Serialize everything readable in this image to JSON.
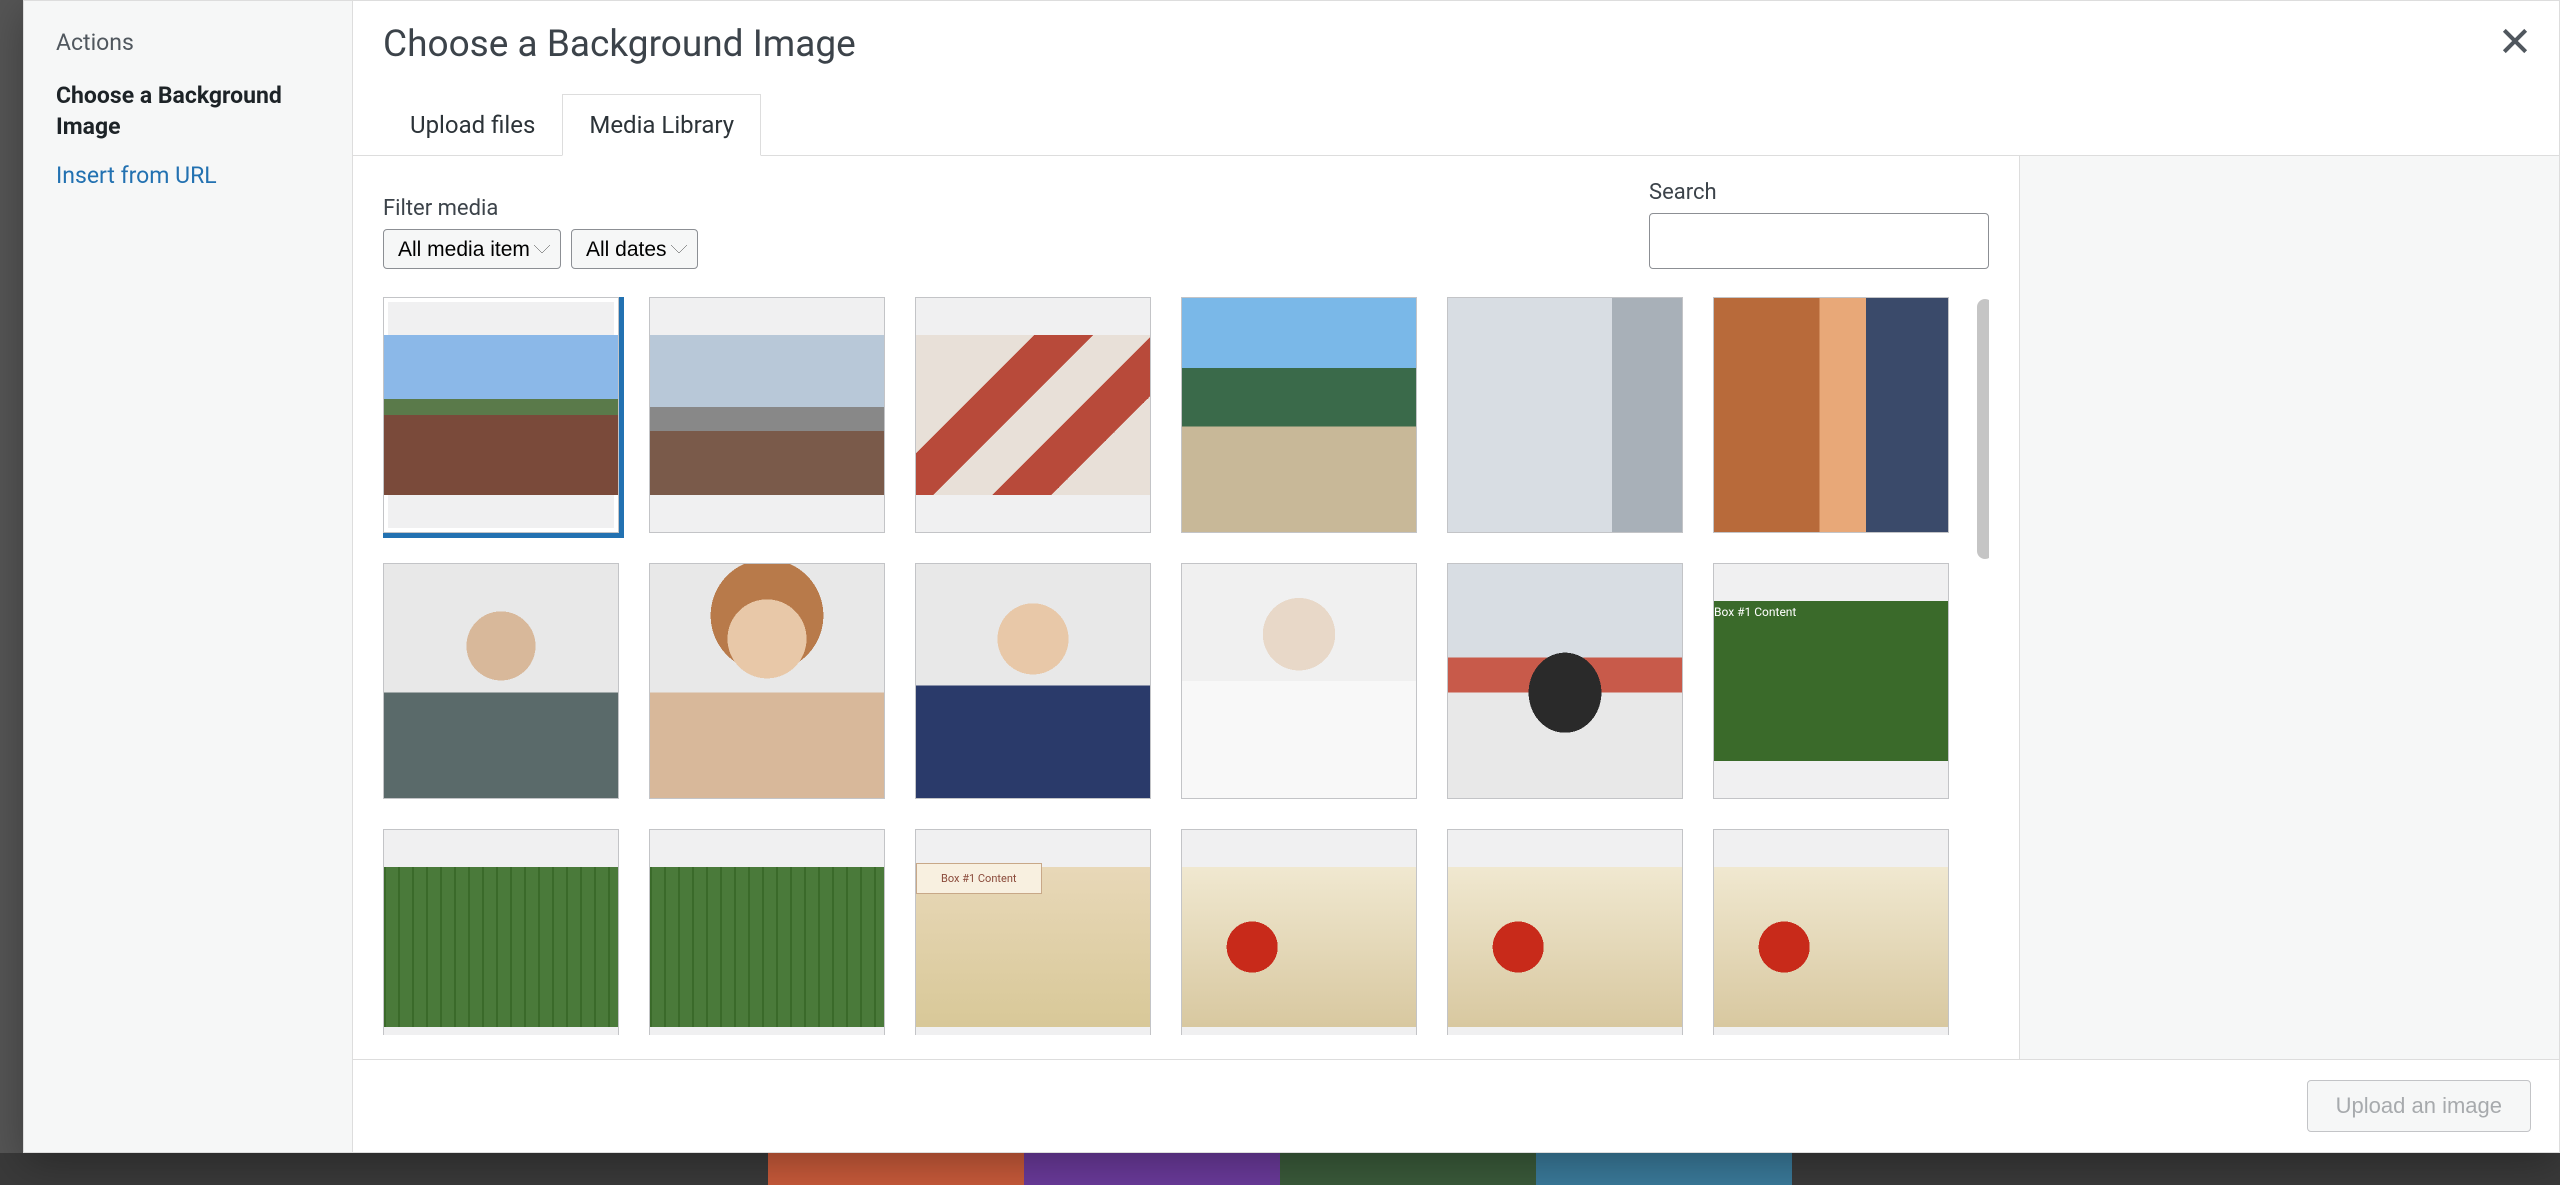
{
  "sidebar": {
    "heading": "Actions",
    "items": [
      {
        "label": "Choose a Background Image",
        "active": true
      },
      {
        "label": "Insert from URL",
        "active": false
      }
    ]
  },
  "header": {
    "title": "Choose a Background Image"
  },
  "tabs": [
    {
      "label": "Upload files",
      "active": false
    },
    {
      "label": "Media Library",
      "active": true
    }
  ],
  "filters": {
    "label": "Filter media",
    "type_options": [
      "All media item"
    ],
    "date_options": [
      "All dates"
    ]
  },
  "search": {
    "label": "Search",
    "value": ""
  },
  "footer": {
    "button_label": "Upload an image"
  },
  "thumbs": [
    {
      "art": "art-building-brick",
      "letterbox": true,
      "selected": true
    },
    {
      "art": "art-building-street",
      "letterbox": true,
      "selected": false
    },
    {
      "art": "art-building-balcony",
      "letterbox": true,
      "selected": false
    },
    {
      "art": "art-building-tropical",
      "letterbox": false,
      "selected": false
    },
    {
      "art": "art-building-modern",
      "letterbox": false,
      "selected": false
    },
    {
      "art": "art-building-orange",
      "letterbox": false,
      "selected": false
    },
    {
      "art": "art-person-1",
      "letterbox": false,
      "selected": false
    },
    {
      "art": "art-person-2",
      "letterbox": false,
      "selected": false
    },
    {
      "art": "art-person-3",
      "letterbox": false,
      "selected": false
    },
    {
      "art": "art-person-4",
      "letterbox": false,
      "selected": false
    },
    {
      "art": "art-handshake",
      "letterbox": false,
      "selected": false
    },
    {
      "art": "art-box-green",
      "letterbox": true,
      "selected": false
    },
    {
      "art": "art-leaf",
      "letterbox": true,
      "selected": false
    },
    {
      "art": "art-leaf",
      "letterbox": true,
      "selected": false
    },
    {
      "art": "art-box-wheat",
      "letterbox": true,
      "selected": false
    },
    {
      "art": "art-poppy",
      "letterbox": true,
      "selected": false
    },
    {
      "art": "art-poppy",
      "letterbox": true,
      "selected": false
    },
    {
      "art": "art-poppy",
      "letterbox": true,
      "selected": false
    }
  ],
  "bg_colors": [
    "#3a3a3a",
    "#3a3a3a",
    "#3a3a3a",
    "#c85a3a",
    "#6a3a9a",
    "#3a5a3a",
    "#3a7a9a",
    "#3a3a3a",
    "#3a3a3a",
    "#3a3a3a"
  ]
}
